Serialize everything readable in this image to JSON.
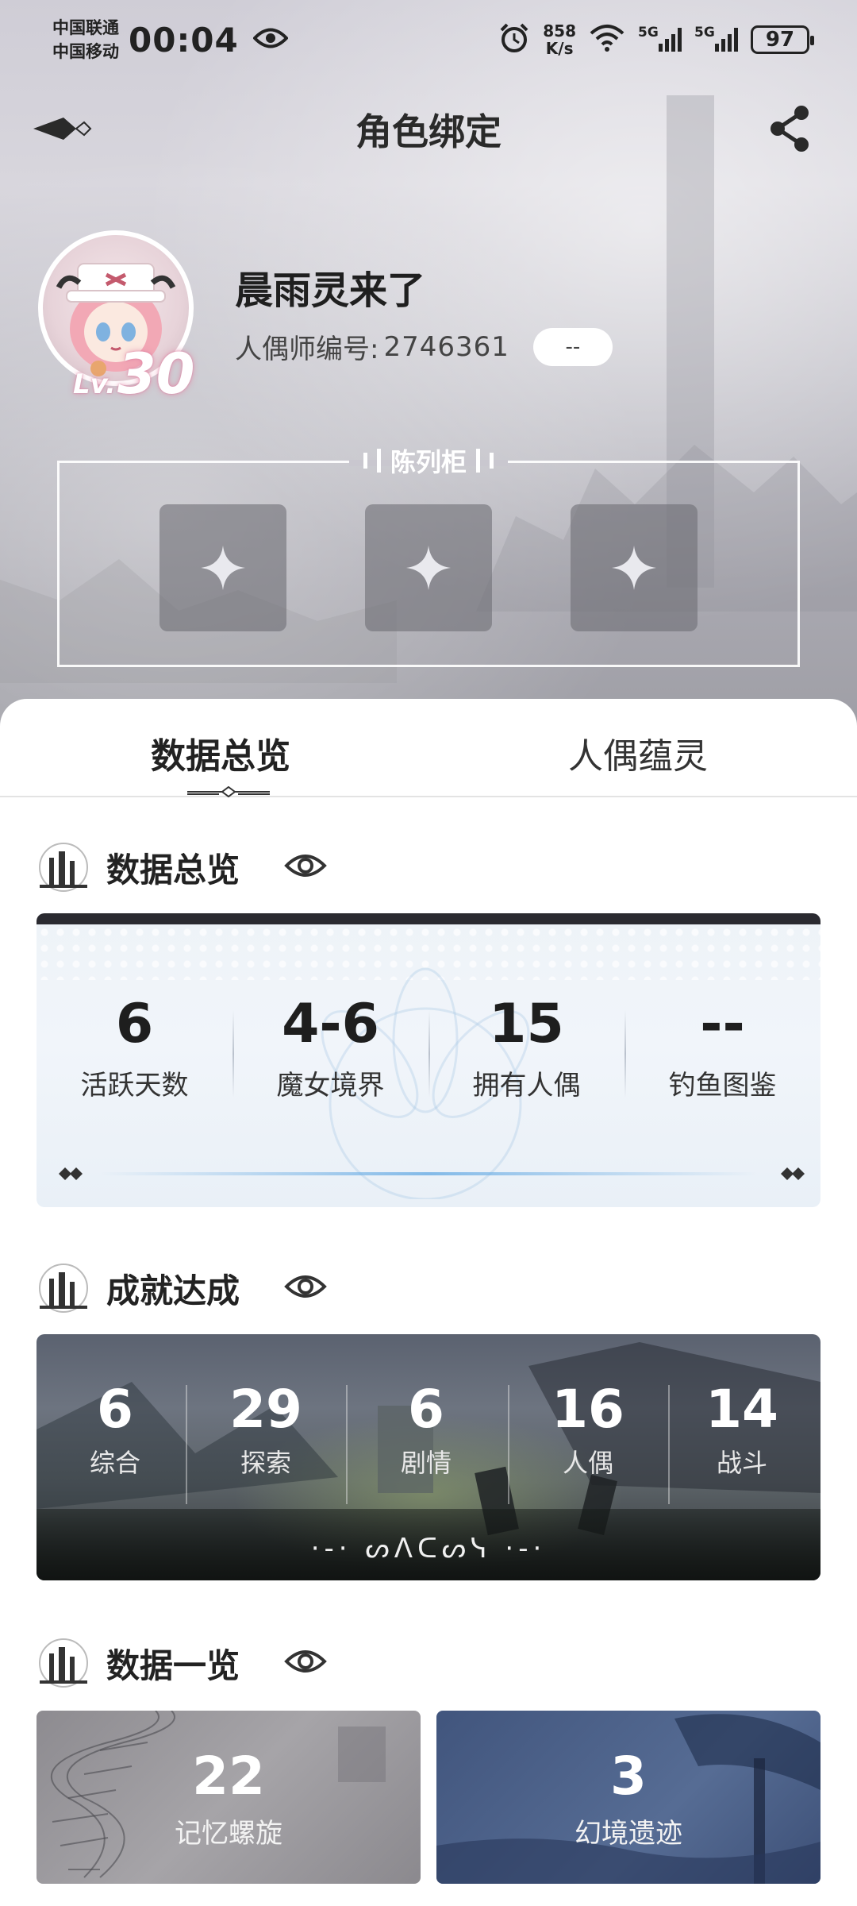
{
  "status_bar": {
    "carrier_1": "中国联通",
    "carrier_2": "中国移动",
    "time": "00:04",
    "net_speed_value": "858",
    "net_speed_unit": "K/s",
    "signal_1_label": "5G",
    "signal_2_label": "5G",
    "battery": "97"
  },
  "header": {
    "title": "角色绑定"
  },
  "profile": {
    "name": "晨雨灵来了",
    "uid_label": "人偶师编号:",
    "uid": "2746361",
    "badge": "--",
    "level_prefix": "Lv.",
    "level": "30"
  },
  "display_case": {
    "title": "陈列柜",
    "slots": 3
  },
  "tabs": [
    {
      "label": "数据总览",
      "active": true
    },
    {
      "label": "人偶蕴灵",
      "active": false
    }
  ],
  "sections": {
    "overview": {
      "title": "数据总览",
      "stats": [
        {
          "value": "6",
          "label": "活跃天数"
        },
        {
          "value": "4-6",
          "label": "魔女境界"
        },
        {
          "value": "15",
          "label": "拥有人偶"
        },
        {
          "value": "--",
          "label": "钓鱼图鉴"
        }
      ]
    },
    "achievements": {
      "title": "成就达成",
      "stats": [
        {
          "value": "6",
          "label": "综合"
        },
        {
          "value": "29",
          "label": "探索"
        },
        {
          "value": "6",
          "label": "剧情"
        },
        {
          "value": "16",
          "label": "人偶"
        },
        {
          "value": "14",
          "label": "战斗"
        }
      ],
      "rune_text": "·-· ᔕᐱᑕᔕᓭ ·-·"
    },
    "data_list": {
      "title": "数据一览",
      "cards": [
        {
          "value": "22",
          "label": "记忆螺旋"
        },
        {
          "value": "3",
          "label": "幻境遗迹"
        }
      ]
    }
  },
  "colors": {
    "accent_dark": "#2a2a30",
    "card_blue": "#41557d",
    "level_glow": "#e68caa"
  }
}
